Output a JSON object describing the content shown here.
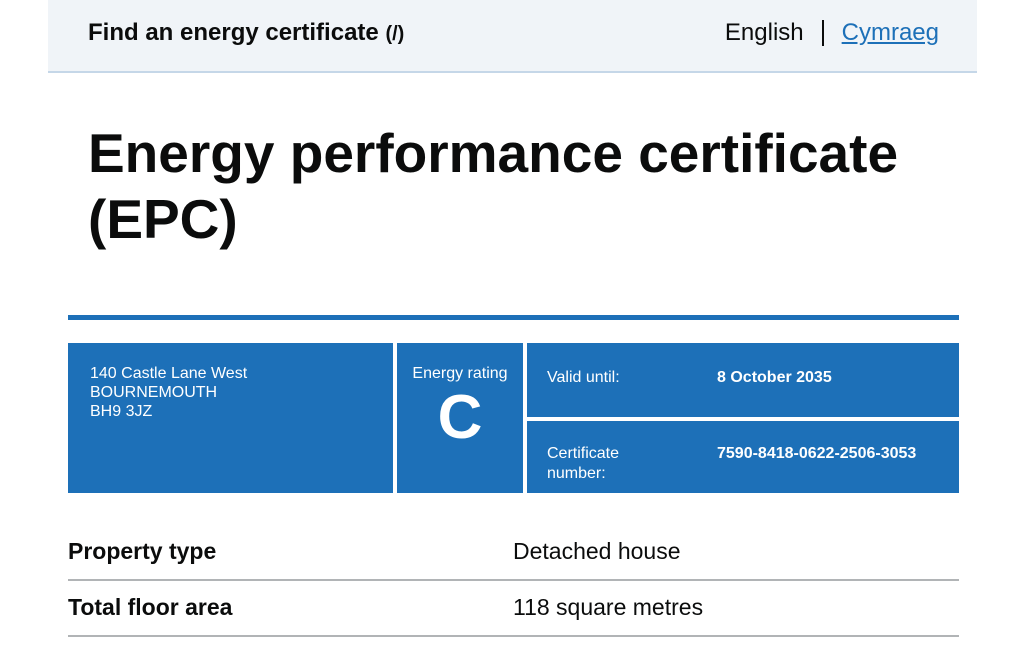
{
  "header": {
    "service_name": "Find an energy certificate",
    "service_suffix": "(/)",
    "lang_current": "English",
    "lang_other": "Cymraeg"
  },
  "page": {
    "title": "Energy performance certificate (EPC)"
  },
  "certificate": {
    "address_lines": [
      "140 Castle Lane West",
      "BOURNEMOUTH",
      "BH9 3JZ"
    ],
    "rating_label": "Energy rating",
    "rating": "C",
    "valid_until_label": "Valid until:",
    "valid_until": "8 October 2035",
    "certificate_number_label_1": "Certificate",
    "certificate_number_label_2": "number:",
    "certificate_number": "7590-8418-0622-2506-3053"
  },
  "summary": [
    {
      "key": "Property type",
      "value": "Detached house"
    },
    {
      "key": "Total floor area",
      "value": "118 square metres"
    }
  ],
  "colors": {
    "accent": "#1d70b8",
    "header_bg": "#f0f4f8"
  }
}
